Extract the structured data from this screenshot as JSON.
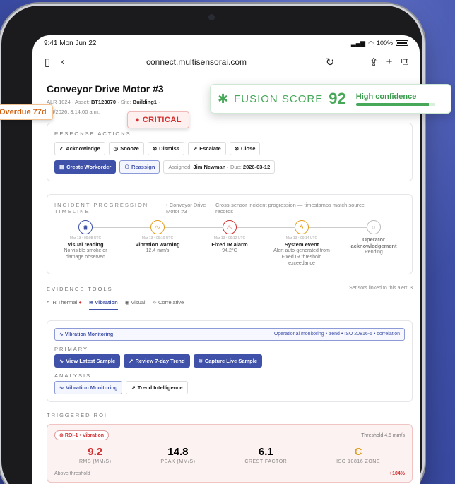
{
  "status": {
    "time": "9:41  Mon Jun 22",
    "signal": "100%"
  },
  "browser": {
    "url": "connect.multisensorai.com"
  },
  "header": {
    "title": "Conveyor Drive Motor #3",
    "alert_id": "ALR-1024",
    "asset_label": "Asset:",
    "asset": "BT123070",
    "site_label": "Site:",
    "site": "Building1",
    "timestamp": "2/3/2026, 3:14:00 a.m."
  },
  "overdue": "Overdue 77d",
  "critical": "CRITICAL",
  "fusion": {
    "label": "FUSION SCORE",
    "score": "92",
    "confidence": "High confidence",
    "level": 0.92
  },
  "response": {
    "label": "Response Actions",
    "actions": [
      "Acknowledge",
      "Snooze",
      "Dismiss",
      "Escalate",
      "Close"
    ],
    "create_workorder": "Create Workorder",
    "reassign": "Reassign",
    "assigned_label": "Assigned:",
    "assignee": "Jim Newman",
    "due_label": "Due:",
    "due": "2026-03-12"
  },
  "timeline": {
    "label": "Incident Progression Timeline",
    "asset": "• Conveyor Drive Motor #3",
    "note": "Cross-sensor incident progression — timestamps match source records",
    "items": [
      {
        "time": "Mar 13 • 09:08 UTC",
        "title": "Visual reading",
        "desc": "No visible smoke or damage observed",
        "color": "#3f51a8"
      },
      {
        "time": "Mar 13 • 09:10 UTC",
        "title": "Vibration warning",
        "desc": "12.4 mm/s",
        "color": "#e0a020"
      },
      {
        "time": "Mar 13 • 09:12 UTC",
        "title": "Fixed IR alarm",
        "desc": "94.2°C",
        "color": "#d03030"
      },
      {
        "time": "Mar 13 • 09:14 UTC",
        "title": "System event",
        "desc": "Alert auto-generated from Fixed IR threshold exceedance",
        "color": "#e0a020"
      },
      {
        "time": "",
        "title": "Operator acknowledgement",
        "desc": "Pending",
        "color": "#aaaaaa"
      }
    ]
  },
  "evidence": {
    "label": "Evidence Tools",
    "sensors": "Sensors linked to this alert: 3",
    "tabs": [
      "IR Thermal",
      "Vibration",
      "Visual",
      "Correlative"
    ],
    "monitoring_title": "Vibration Monitoring",
    "monitoring_meta": "Operational monitoring • trend • ISO 20816-5 • correlation",
    "primary_label": "Primary",
    "primary_buttons": [
      "View Latest Sample",
      "Review 7-day Trend",
      "Capture Live Sample"
    ],
    "analysis_label": "Analysis",
    "analysis_buttons": [
      "Vibration Monitoring",
      "Trend Intelligence"
    ]
  },
  "roi": {
    "label": "Triggered ROI",
    "badge": "ROI-1 • Vibration",
    "threshold": "Threshold 4.5 mm/s",
    "metrics": [
      {
        "value": "9.2",
        "label": "RMS (MM/S)",
        "color": "#d03030"
      },
      {
        "value": "14.8",
        "label": "PEAK (MM/S)",
        "color": "#222222"
      },
      {
        "value": "6.1",
        "label": "CREST FACTOR",
        "color": "#222222"
      },
      {
        "value": "C",
        "label": "ISO 10816 ZONE",
        "color": "#e0a020"
      }
    ],
    "footer_left": "Above threshold",
    "footer_right": "+104%"
  }
}
